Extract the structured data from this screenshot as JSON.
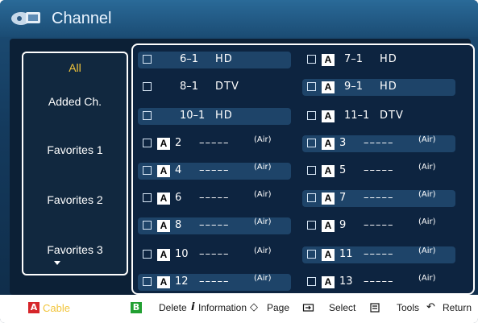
{
  "title": "Channel",
  "sidebar": {
    "items": [
      "All",
      "Added Ch.",
      "Favorites 1",
      "Favorites 2",
      "Favorites 3"
    ],
    "selected_index": 0
  },
  "channels": [
    {
      "num": "6–1",
      "label": "HD",
      "type": "",
      "antenna": false
    },
    {
      "num": "7–1",
      "label": "HD",
      "type": "",
      "antenna": true
    },
    {
      "num": "8–1",
      "label": "DTV",
      "type": "",
      "antenna": false
    },
    {
      "num": "9–1",
      "label": "HD",
      "type": "",
      "antenna": true
    },
    {
      "num": "10–1",
      "label": "HD",
      "type": "",
      "antenna": false
    },
    {
      "num": "11–1",
      "label": "DTV",
      "type": "",
      "antenna": true
    },
    {
      "num": "2",
      "label": "–––––",
      "type": "(Air)",
      "antenna": true
    },
    {
      "num": "3",
      "label": "–––––",
      "type": "(Air)",
      "antenna": true
    },
    {
      "num": "4",
      "label": "–––––",
      "type": "(Air)",
      "antenna": true
    },
    {
      "num": "5",
      "label": "–––––",
      "type": "(Air)",
      "antenna": true
    },
    {
      "num": "6",
      "label": "–––––",
      "type": "(Air)",
      "antenna": true
    },
    {
      "num": "7",
      "label": "–––––",
      "type": "(Air)",
      "antenna": true
    },
    {
      "num": "8",
      "label": "–––––",
      "type": "(Air)",
      "antenna": true
    },
    {
      "num": "9",
      "label": "–––––",
      "type": "(Air)",
      "antenna": true
    },
    {
      "num": "10",
      "label": "–––––",
      "type": "(Air)",
      "antenna": true
    },
    {
      "num": "11",
      "label": "–––––",
      "type": "(Air)",
      "antenna": true
    },
    {
      "num": "12",
      "label": "–––––",
      "type": "(Air)",
      "antenna": true
    },
    {
      "num": "13",
      "label": "–––––",
      "type": "(Air)",
      "antenna": true
    }
  ],
  "antenna_badge": "A",
  "footer": {
    "red_key": "A",
    "red_label": "Cable",
    "green_key": "B",
    "green_label": "Delete",
    "info_icon": "i",
    "info_label": "Information",
    "page_label": "Page",
    "select_label": "Select",
    "tools_label": "Tools",
    "return_label": "Return"
  },
  "colors": {
    "accent_yellow": "#f2c53b",
    "panel_blue": "#1e4469",
    "red_key": "#d6262a",
    "green_key": "#22a032"
  }
}
